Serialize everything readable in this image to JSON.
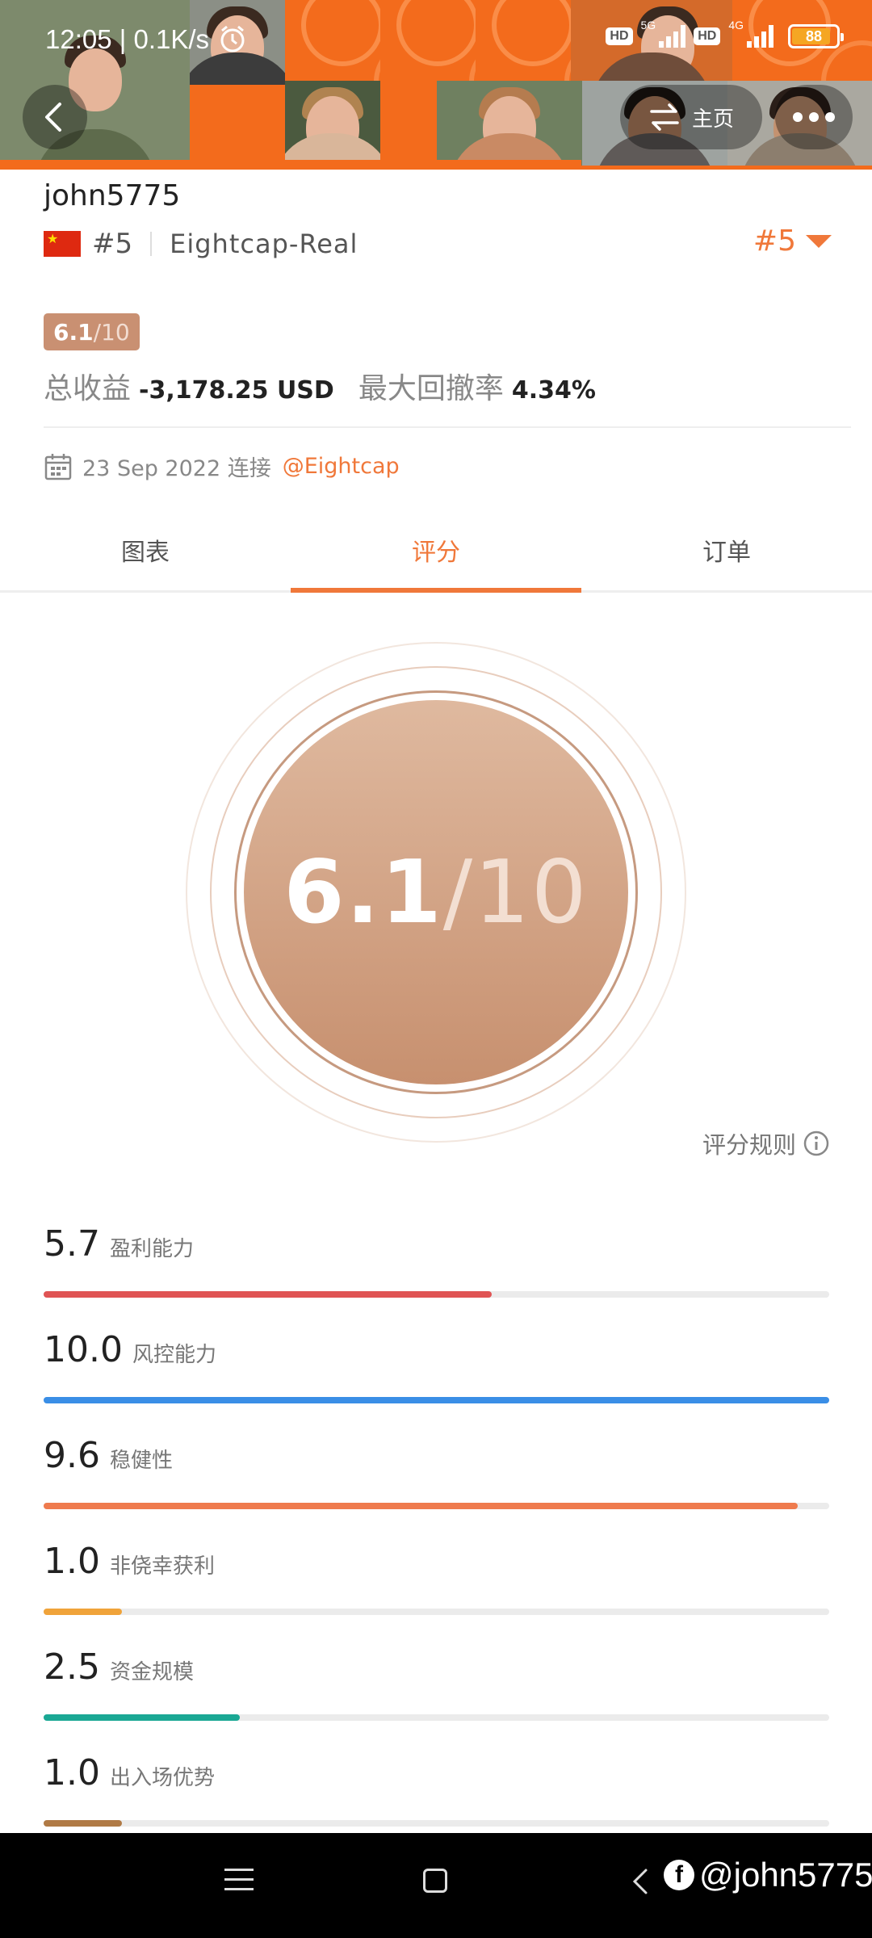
{
  "status_bar": {
    "time_speed": "12:05 | 0.1K/s",
    "hd1": "HD",
    "net1": "5G",
    "hd2": "HD",
    "net2": "4G",
    "battery": "88",
    "battery_level": 0.88
  },
  "header": {
    "home_label": "主页"
  },
  "profile": {
    "username": "john5775",
    "rank": "#5",
    "broker": "Eightcap-Real",
    "rank_right": "#5",
    "score_value": "6.1",
    "score_den": "/10",
    "total_profit_label": "总收益",
    "total_profit_value": "-3,178.25 USD",
    "max_drawdown_label": "最大回撤率",
    "max_drawdown_value": "4.34%",
    "connect_date": "23 Sep 2022 连接",
    "connect_link": "@Eightcap"
  },
  "tabs": [
    {
      "label": "图表"
    },
    {
      "label": "评分"
    },
    {
      "label": "订单"
    }
  ],
  "score_circle": {
    "value": "6.1",
    "den": "/10"
  },
  "rules_link": "评分规则",
  "metrics": [
    {
      "value": "5.7",
      "label": "盈利能力",
      "score": 5.7,
      "color": "#e05454"
    },
    {
      "value": "10.0",
      "label": "风控能力",
      "score": 10.0,
      "color": "#3a8ee6"
    },
    {
      "value": "9.6",
      "label": "稳健性",
      "score": 9.6,
      "color": "#ef7b4e"
    },
    {
      "value": "1.0",
      "label": "非侥幸获利",
      "score": 1.0,
      "color": "#f0a33a"
    },
    {
      "value": "2.5",
      "label": "资金规模",
      "score": 2.5,
      "color": "#1aa894"
    },
    {
      "value": "1.0",
      "label": "出入场优势",
      "score": 1.0,
      "color": "#b07a45"
    }
  ],
  "watermark": "@john5775",
  "colors": {
    "accent": "#f0783a",
    "score_badge": "#c99072"
  }
}
